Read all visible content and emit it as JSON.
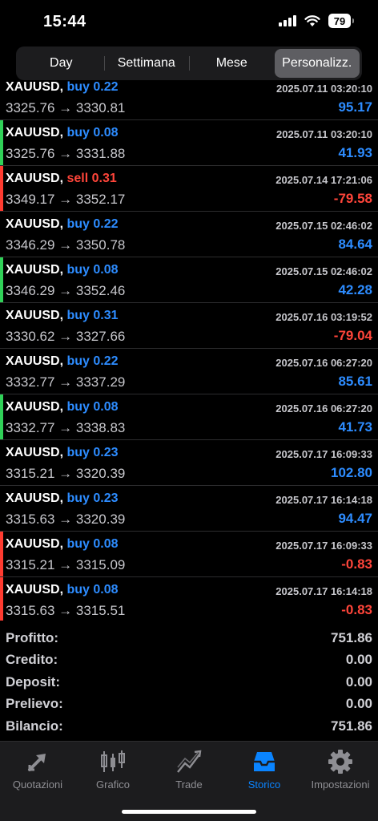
{
  "status_bar": {
    "time": "15:44",
    "battery": "79"
  },
  "segments": [
    {
      "label": "Day",
      "active": false
    },
    {
      "label": "Settimana",
      "active": false
    },
    {
      "label": "Mese",
      "active": false
    },
    {
      "label": "Personalizz.",
      "active": true
    }
  ],
  "colors": {
    "buy": "#2d8cff",
    "sell": "#ff453a",
    "profit_pos": "#2d8cff",
    "profit_neg": "#ff453a",
    "bar_green": "#30d158",
    "bar_red": "#ff3b30"
  },
  "deals": [
    {
      "symbol": "XAUUSD,",
      "side": "buy 0.22",
      "type": "buy",
      "prices": "3325.76 → 3330.81",
      "time": "2025.07.11 03:20:10",
      "profit": "95.17",
      "bar": ""
    },
    {
      "symbol": "XAUUSD,",
      "side": "buy 0.08",
      "type": "buy",
      "prices": "3325.76 → 3331.88",
      "time": "2025.07.11 03:20:10",
      "profit": "41.93",
      "bar": "green"
    },
    {
      "symbol": "XAUUSD,",
      "side": "sell 0.31",
      "type": "sell",
      "prices": "3349.17 → 3352.17",
      "time": "2025.07.14 17:21:06",
      "profit": "-79.58",
      "bar": "red"
    },
    {
      "symbol": "XAUUSD,",
      "side": "buy 0.22",
      "type": "buy",
      "prices": "3346.29 → 3350.78",
      "time": "2025.07.15 02:46:02",
      "profit": "84.64",
      "bar": ""
    },
    {
      "symbol": "XAUUSD,",
      "side": "buy 0.08",
      "type": "buy",
      "prices": "3346.29 → 3352.46",
      "time": "2025.07.15 02:46:02",
      "profit": "42.28",
      "bar": "green"
    },
    {
      "symbol": "XAUUSD,",
      "side": "buy 0.31",
      "type": "buy",
      "prices": "3330.62 → 3327.66",
      "time": "2025.07.16 03:19:52",
      "profit": "-79.04",
      "bar": ""
    },
    {
      "symbol": "XAUUSD,",
      "side": "buy 0.22",
      "type": "buy",
      "prices": "3332.77 → 3337.29",
      "time": "2025.07.16 06:27:20",
      "profit": "85.61",
      "bar": ""
    },
    {
      "symbol": "XAUUSD,",
      "side": "buy 0.08",
      "type": "buy",
      "prices": "3332.77 → 3338.83",
      "time": "2025.07.16 06:27:20",
      "profit": "41.73",
      "bar": "green"
    },
    {
      "symbol": "XAUUSD,",
      "side": "buy 0.23",
      "type": "buy",
      "prices": "3315.21 → 3320.39",
      "time": "2025.07.17 16:09:33",
      "profit": "102.80",
      "bar": ""
    },
    {
      "symbol": "XAUUSD,",
      "side": "buy 0.23",
      "type": "buy",
      "prices": "3315.63 → 3320.39",
      "time": "2025.07.17 16:14:18",
      "profit": "94.47",
      "bar": ""
    },
    {
      "symbol": "XAUUSD,",
      "side": "buy 0.08",
      "type": "buy",
      "prices": "3315.21 → 3315.09",
      "time": "2025.07.17 16:09:33",
      "profit": "-0.83",
      "bar": "red"
    },
    {
      "symbol": "XAUUSD,",
      "side": "buy 0.08",
      "type": "buy",
      "prices": "3315.63 → 3315.51",
      "time": "2025.07.17 16:14:18",
      "profit": "-0.83",
      "bar": "red"
    }
  ],
  "summary": [
    {
      "label": "Profitto:",
      "value": "751.86"
    },
    {
      "label": "Credito:",
      "value": "0.00"
    },
    {
      "label": "Deposit:",
      "value": "0.00"
    },
    {
      "label": "Prelievo:",
      "value": "0.00"
    },
    {
      "label": "Bilancio:",
      "value": "751.86"
    }
  ],
  "tabs": [
    {
      "label": "Quotazioni",
      "icon": "quotes-icon",
      "active": false
    },
    {
      "label": "Grafico",
      "icon": "chart-icon",
      "active": false
    },
    {
      "label": "Trade",
      "icon": "trade-icon",
      "active": false
    },
    {
      "label": "Storico",
      "icon": "history-icon",
      "active": true
    },
    {
      "label": "Impostazioni",
      "icon": "gear-icon",
      "active": false
    }
  ]
}
